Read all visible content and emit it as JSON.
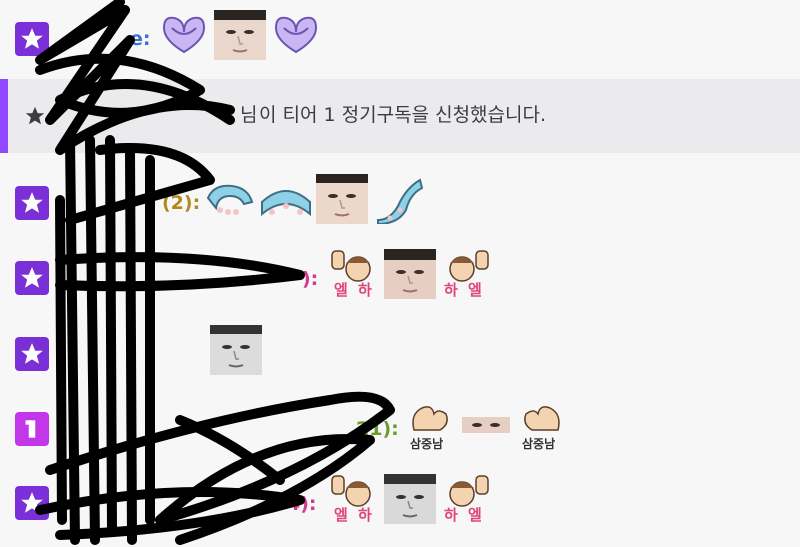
{
  "colors": {
    "badge": "#7b2fd6",
    "badge_alt": "#c238e8",
    "notice_accent": "#9147ff",
    "name_blue": "#3b6fd4",
    "name_gold": "#b08a1e",
    "name_pink": "#d13b8e",
    "name_green": "#6a9a2a"
  },
  "chat": {
    "notice_text": "이 티어 1 정기구독을 신청했습니다.",
    "notice_prefix": "님",
    "messages": [
      {
        "name_visible": "e:",
        "emotes": [
          "heart-hands-emote",
          "face-emote",
          "heart-hands-emote"
        ]
      },
      {
        "name_visible": "(2):",
        "emotes": [
          "tentacle-emote",
          "tentacle-emote",
          "face-emote",
          "tentacle-emote"
        ]
      },
      {
        "name_visible": "):",
        "emotes": [
          "hands-up-emote",
          "face-emote",
          "hands-up-emote"
        ]
      },
      {
        "name_visible": "",
        "emotes": [
          "face-emote"
        ]
      },
      {
        "name_visible": "21):",
        "emotes": [
          "flex-emote",
          "face-strip-emote",
          "flex-emote"
        ]
      },
      {
        "name_visible": "4):",
        "emotes": [
          "hands-up-emote",
          "face-emote",
          "hands-up-emote"
        ]
      }
    ]
  },
  "emote_captions": {
    "hands_left": "엘",
    "hands_left2": "하",
    "hands_right": "하",
    "hands_right2": "엘",
    "flex": "삼중남"
  }
}
